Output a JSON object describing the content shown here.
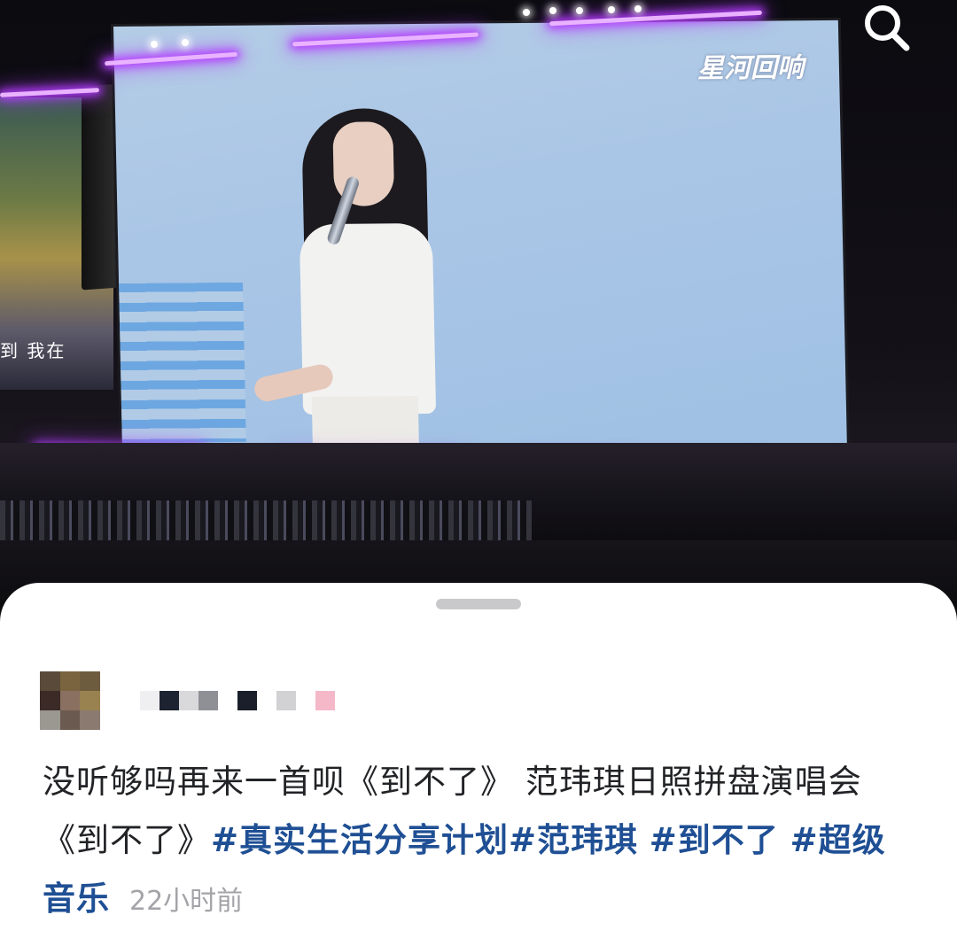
{
  "video": {
    "watermark": "星河回响",
    "side_screen_text": "到 我在"
  },
  "colors": {
    "hashtag": "#1f4f94",
    "text": "#222326",
    "muted": "#a3a3a8",
    "neon": "#b53cff",
    "screen": "#aac6e6"
  },
  "icons": {
    "search": "search-icon"
  },
  "post": {
    "avatar_pixels": [
      "#5a4a3a",
      "#7a6440",
      "#6e5c3e",
      "#3b2a26",
      "#8a7060",
      "#9a8250",
      "#9a9890",
      "#6b5a50",
      "#8a7a70"
    ],
    "username_blocks": [
      "#efeff1",
      "#1d2330",
      "#d9d9dc",
      "#8f9096",
      "#ffffff",
      "#1a1f2b",
      "#ffffff",
      "#d2d2d5",
      "#ffffff",
      "#f4b8c8"
    ],
    "text_plain_1": "没听够吗再来一首呗《到不了》 范玮琪日照拼盘演唱会《到不了》",
    "hashtags": [
      "#真实生活分享计划",
      "#范玮琪",
      "#到不了",
      "#超级音乐"
    ],
    "time": "22小时前"
  }
}
